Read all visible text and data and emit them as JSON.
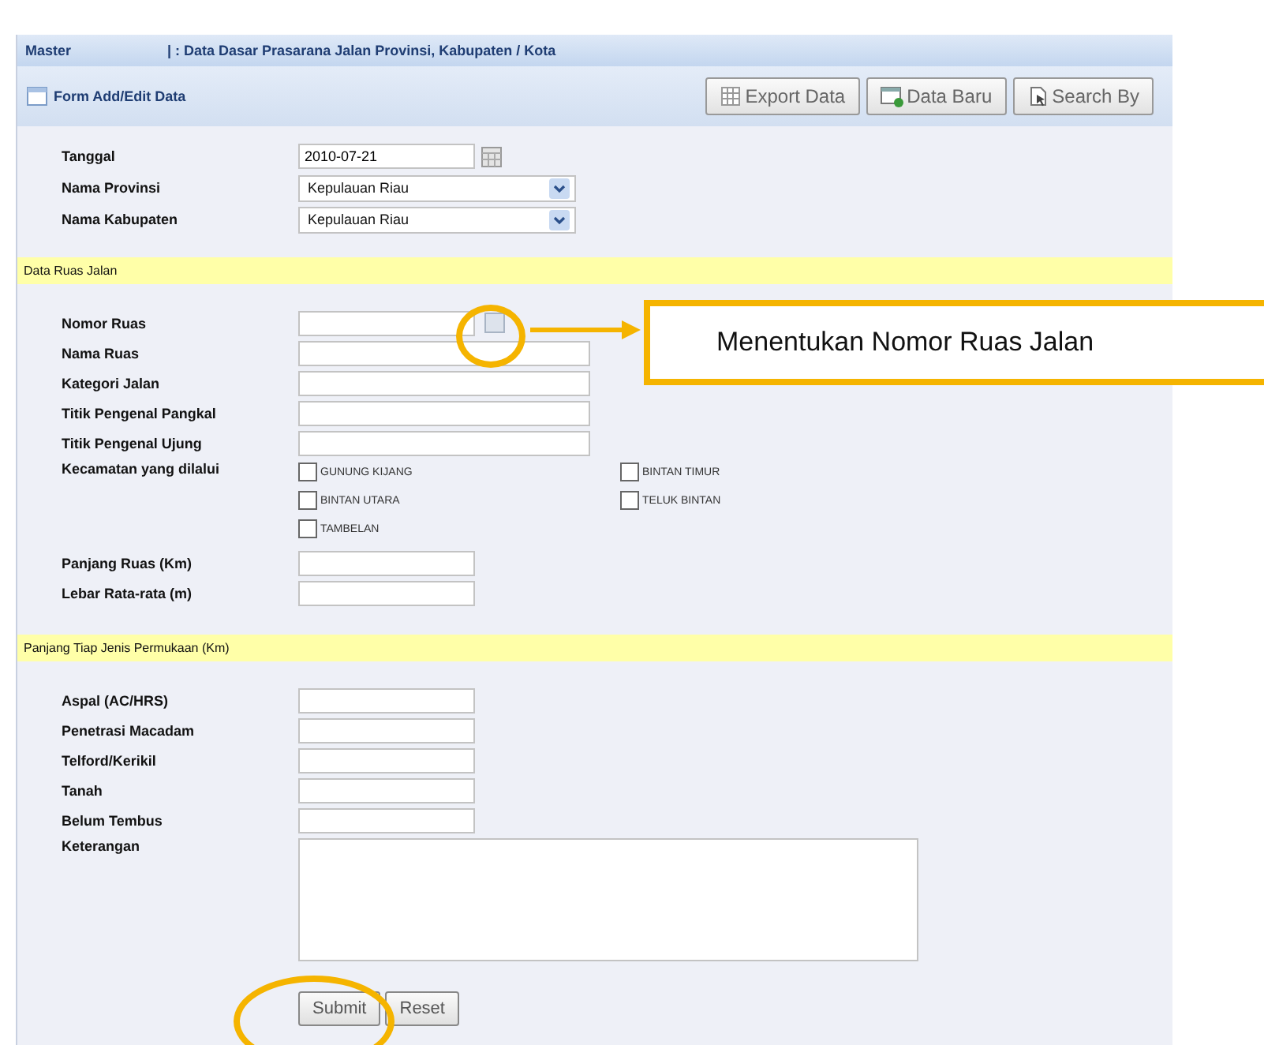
{
  "header": {
    "section": "Master",
    "breadcrumb": "| : Data Dasar Prasarana Jalan Provinsi, Kabupaten / Kota"
  },
  "form": {
    "title": "Form Add/Edit Data",
    "toolbar": [
      {
        "label": "Export Data",
        "kind": "export"
      },
      {
        "label": "Data Baru",
        "kind": "new"
      },
      {
        "label": "Search By",
        "kind": "search"
      }
    ],
    "fields": [
      {
        "label": "Tanggal",
        "kind": "date",
        "value": "2010-07-21"
      },
      {
        "label": "Nama Provinsi",
        "kind": "select",
        "value": "Kepulauan Riau"
      },
      {
        "label": "Nama Kabupaten",
        "kind": "select",
        "value": "Kepulauan Riau"
      }
    ]
  },
  "sections": [
    {
      "title": "Data Ruas Jalan",
      "fields": [
        {
          "label": "Nomor Ruas",
          "kind": "lookup"
        },
        {
          "label": "Nama Ruas",
          "kind": "text"
        },
        {
          "label": "Kategori Jalan",
          "kind": "text"
        },
        {
          "label": "Titik Pengenal Pangkal",
          "kind": "text"
        },
        {
          "label": "Titik Pengenal Ujung",
          "kind": "text"
        },
        {
          "label": "Kecamatan yang dilalui",
          "kind": "checkboxes",
          "options": [
            {
              "label": "GUNUNG KIJANG",
              "checked": false
            },
            {
              "label": "BINTAN TIMUR",
              "checked": false
            },
            {
              "label": "BINTAN UTARA",
              "checked": false
            },
            {
              "label": "TELUK BINTAN",
              "checked": false
            },
            {
              "label": "TAMBELAN",
              "checked": false
            }
          ]
        },
        {
          "label": "Panjang Ruas (Km)",
          "kind": "short"
        },
        {
          "label": "Lebar Rata-rata (m)",
          "kind": "short"
        }
      ]
    },
    {
      "title": "Panjang Tiap Jenis Permukaan (Km)",
      "fields": [
        {
          "label": "Aspal (AC/HRS)",
          "kind": "short"
        },
        {
          "label": "Penetrasi Macadam",
          "kind": "short"
        },
        {
          "label": "Telford/Kerikil",
          "kind": "short"
        },
        {
          "label": "Tanah",
          "kind": "short"
        },
        {
          "label": "Belum Tembus",
          "kind": "short"
        },
        {
          "label": "Keterangan",
          "kind": "textarea"
        }
      ]
    }
  ],
  "buttons": [
    "Submit",
    "Reset"
  ],
  "annotation": {
    "text": "Menentukan Nomor Ruas Jalan"
  }
}
